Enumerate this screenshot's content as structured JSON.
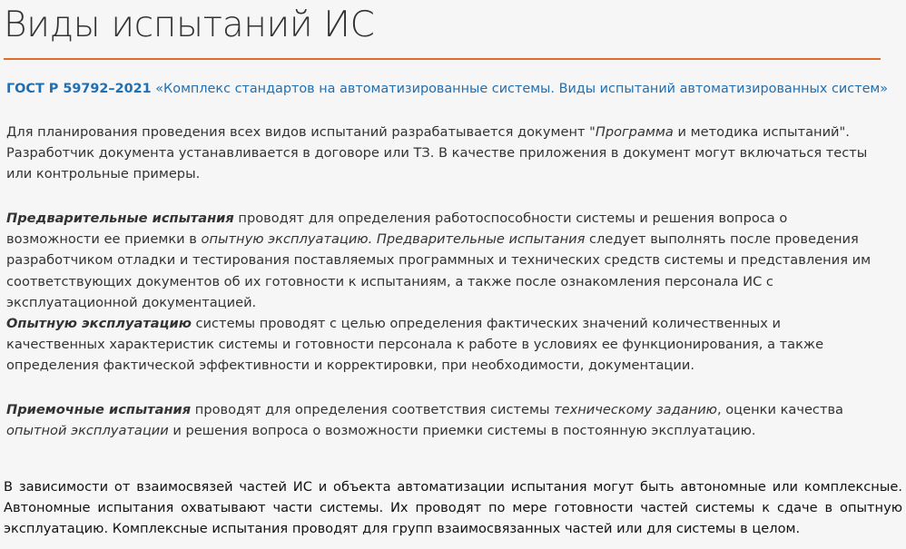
{
  "title": "Виды испытаний ИС",
  "colors": {
    "accent_rule": "#e36c2c",
    "link": "#1f6fb3",
    "text": "#333333",
    "background": "#f6f6f6"
  },
  "gost": {
    "code": "ГОСТ Р 59792–2021",
    "name": "«Комплекс стандартов на автоматизированные системы. Виды испытаний автоматизированных систем»"
  },
  "p1": {
    "a": "Для планирования проведения всех видов испытаний разрабатывается документ \"",
    "b": "Программа",
    "c": " и методика испытаний\". Разработчик документа устанавливается в договоре или ТЗ. В качестве приложения в документ могут включаться тесты или контрольные примеры."
  },
  "p2": {
    "term": "Предварительные испытания",
    "a": " проводят для определения работоспособности системы и решения вопроса о возможности ее приемки в ",
    "b": "опытную эксплуатацию. Предварительные испытания",
    "c": " следует выполнять после проведения разработчиком отладки и тестирования поставляемых программных и технических средств системы и представления им соответствующих документов об их готовности к испытаниям, а также после ознакомления персонала ИС с эксплуатационной документацией."
  },
  "p3": {
    "term": "Опытную эксплуатацию",
    "a": " системы проводят с целью определения фактических значений количественных и качественных характеристик системы и готовности персонала к работе в условиях ее функционирования, а также определения фактической эффективности и корректировки, при необходимости, документации."
  },
  "p4": {
    "term": "Приемочные испытания",
    "a": " проводят для определения соответствия системы ",
    "b": "техническому заданию",
    "c": ", оценки качества ",
    "d": "опытной эксплуатации",
    "e": " и решения вопроса о возможности приемки системы в постоянную эксплуатацию."
  },
  "p5": {
    "text": "В зависимости от взаимосвязей частей ИС и объекта автоматизации испытания могут быть автономные или комплексные. Автономные испытания охватывают части системы. Их проводят по мере готовности частей системы к сдаче в опытную эксплуатацию. Комплексные испытания проводят для групп взаимосвязанных частей или для системы в целом."
  }
}
